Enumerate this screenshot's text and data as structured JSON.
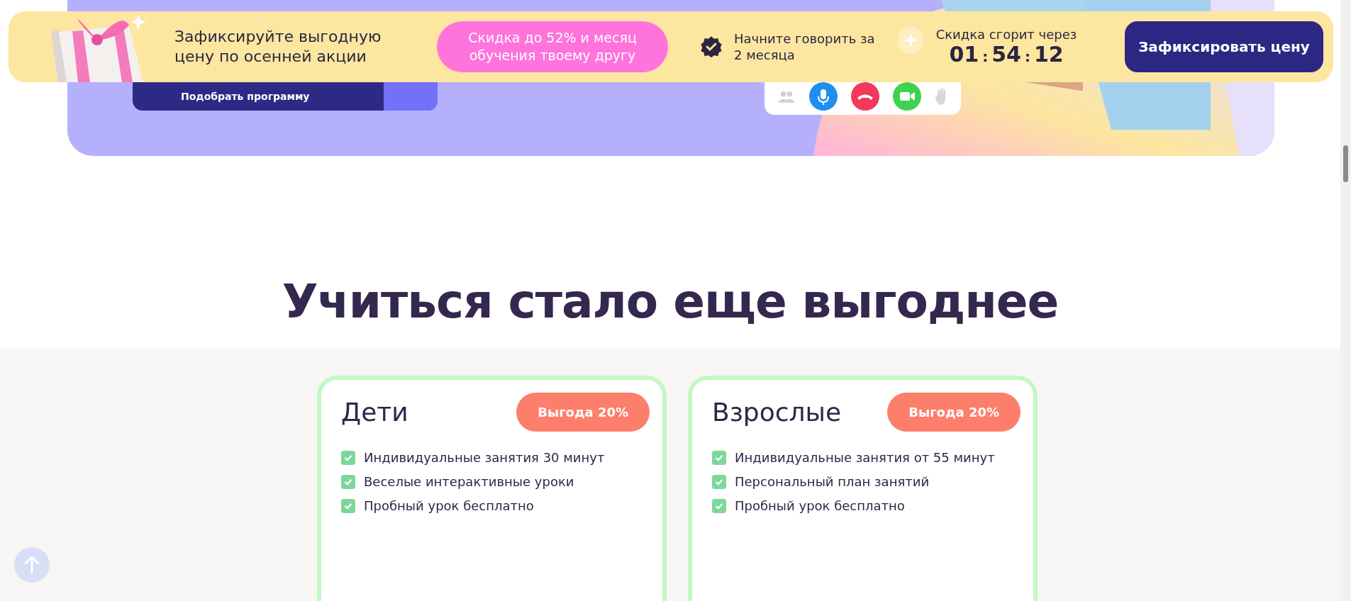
{
  "promo_bar": {
    "title": "Зафиксируйте выгодную цену по осенней акции",
    "offer": "Скидка до 52% и месяц обучения твоему другу",
    "feature": "Начните говорить за 2 месяца",
    "timer_label": "Скидка сгорит через",
    "timer": {
      "hours": "01",
      "minutes": "54",
      "seconds": "12",
      "separator": ":"
    },
    "button": "Зафиксировать цену"
  },
  "hero": {
    "button": "Подобрать программу"
  },
  "section": {
    "heading": "Учиться стало еще выгоднее"
  },
  "plans": [
    {
      "title": "Дети",
      "badge": "Выгода 20%",
      "features": [
        {
          "text": "Индивидуальные занятия 30 минут",
          "checked": true
        },
        {
          "text": "Веселые интерактивные уроки",
          "checked": true
        },
        {
          "text": "Пробный урок бесплатно",
          "checked": true
        }
      ]
    },
    {
      "title": "Взрослые",
      "badge": "Выгода 20%",
      "features": [
        {
          "text": "Индивидуальные занятия от 55 минут",
          "checked": true
        },
        {
          "text": "Персональный план занятий",
          "checked": true
        },
        {
          "text": "Пробный урок бесплатно",
          "checked": true
        }
      ]
    }
  ]
}
